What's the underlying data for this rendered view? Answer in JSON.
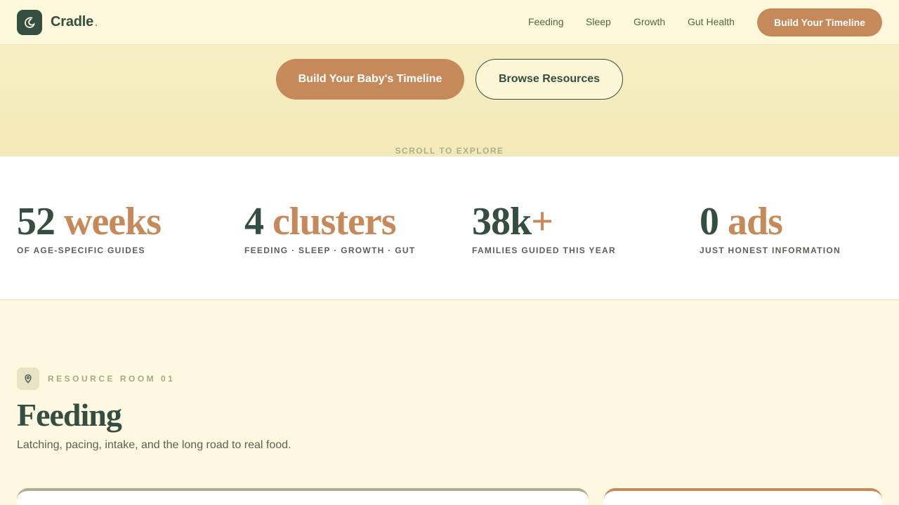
{
  "brand": {
    "name": "Cradle",
    "dot": ".",
    "colors": {
      "primary": "#344e41",
      "accent": "#c5895a",
      "sage": "#a8b08d",
      "cream": "#fdf8df"
    }
  },
  "nav": {
    "links": [
      "Feeding",
      "Sleep",
      "Growth",
      "Gut Health"
    ],
    "cta": "Build Your Timeline"
  },
  "hero": {
    "primary_cta": "Build Your Baby's Timeline",
    "secondary_cta": "Browse Resources",
    "scroll_hint": "SCROLL TO EXPLORE"
  },
  "stats": [
    {
      "number": "52",
      "unit": " weeks",
      "label": "OF AGE-SPECIFIC GUIDES"
    },
    {
      "number": "4",
      "unit": " clusters",
      "label": "FEEDING · SLEEP · GROWTH · GUT"
    },
    {
      "number": "38k",
      "unit": "+",
      "label": "FAMILIES GUIDED THIS YEAR"
    },
    {
      "number": "0",
      "unit": " ads",
      "label": "JUST HONEST INFORMATION"
    }
  ],
  "room": {
    "icon": "map-pin-icon",
    "kicker": "RESOURCE ROOM 01",
    "title": "Feeding",
    "subtitle": "Latching, pacing, intake, and the long road to real food."
  }
}
